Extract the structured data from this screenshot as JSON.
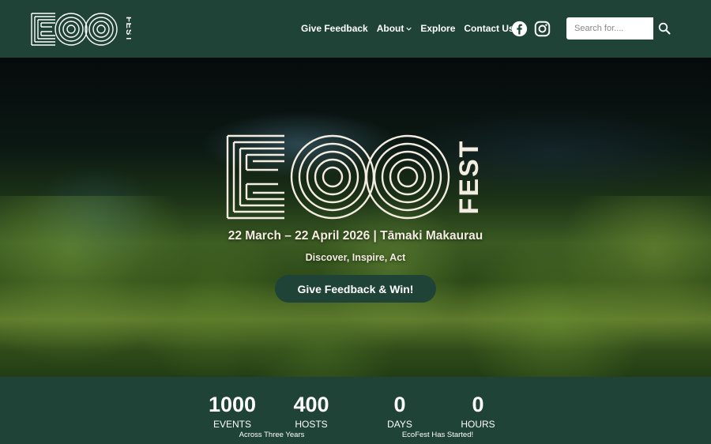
{
  "nav": {
    "items": [
      {
        "label": "Give Feedback"
      },
      {
        "label": "About",
        "has_dropdown": true
      },
      {
        "label": "Explore"
      },
      {
        "label": "Contact Us"
      }
    ]
  },
  "social": [
    "facebook-icon",
    "instagram-icon"
  ],
  "search": {
    "placeholder": "Search for...."
  },
  "hero": {
    "dates": "22 March – 22 April 2026 | Tāmaki Makaurau",
    "tagline": "Discover, Inspire, Act",
    "cta": "Give Feedback & Win!"
  },
  "stats": {
    "events": {
      "value": "1000",
      "label": "EVENTS"
    },
    "hosts": {
      "value": "400",
      "label": "HOSTS"
    },
    "days": {
      "value": "0",
      "label": "DAYS"
    },
    "hours": {
      "value": "0",
      "label": "HOURS"
    },
    "across": "Across Three Years",
    "started": "EcoFest Has Started!"
  },
  "colors": {
    "brand": "#1f4337",
    "cream": "#f3ece0"
  }
}
